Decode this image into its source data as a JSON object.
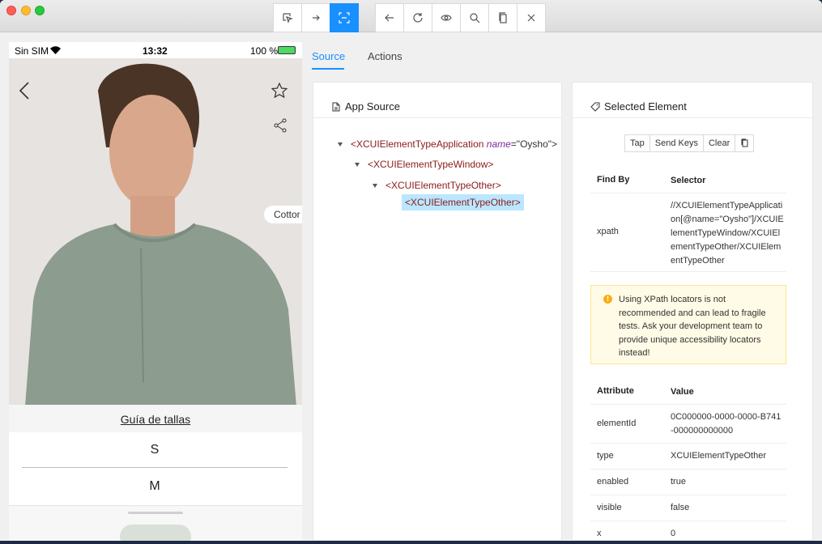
{
  "toolbar": {
    "left_icons": [
      "select-element-icon",
      "swipe-icon",
      "tap-by-coordinates-icon"
    ],
    "right_icons": [
      "back-icon",
      "refresh-icon",
      "eye-icon",
      "search-icon",
      "copy-icon",
      "close-icon"
    ]
  },
  "device": {
    "carrier": "Sin SIM",
    "time": "13:32",
    "battery": "100 %",
    "chip_text": "Cottor",
    "size_guide": "Guía de tallas",
    "sizes": [
      "S",
      "M"
    ]
  },
  "tabs": {
    "source": "Source",
    "actions": "Actions"
  },
  "source_panel": {
    "title": "App Source",
    "tree": {
      "app_tag": "<XCUIElementTypeApplication",
      "app_attr_name": "name",
      "app_attr_value": "=\"Oysho\">",
      "window_tag": "<XCUIElementTypeWindow>",
      "other_tag": "<XCUIElementTypeOther>",
      "selected_tag": "<XCUIElementTypeOther>"
    }
  },
  "selected_panel": {
    "title": "Selected Element",
    "buttons": {
      "tap": "Tap",
      "send_keys": "Send Keys",
      "clear": "Clear"
    },
    "find_by_header": "Find By",
    "selector_header": "Selector",
    "find_by": "xpath",
    "selector": "//XCUIElementTypeApplication[@name=\"Oysho\"]/XCUIElementTypeWindow/XCUIElementTypeOther/XCUIElementTypeOther",
    "warning": "Using XPath locators is not recommended and can lead to fragile tests. Ask your development team to provide unique accessibility locators instead!",
    "attr_header": "Attribute",
    "value_header": "Value",
    "attributes": [
      {
        "name": "elementId",
        "value": "0C000000-0000-0000-B741-000000000000"
      },
      {
        "name": "type",
        "value": "XCUIElementTypeOther"
      },
      {
        "name": "enabled",
        "value": "true"
      },
      {
        "name": "visible",
        "value": "false"
      },
      {
        "name": "x",
        "value": "0"
      }
    ]
  }
}
